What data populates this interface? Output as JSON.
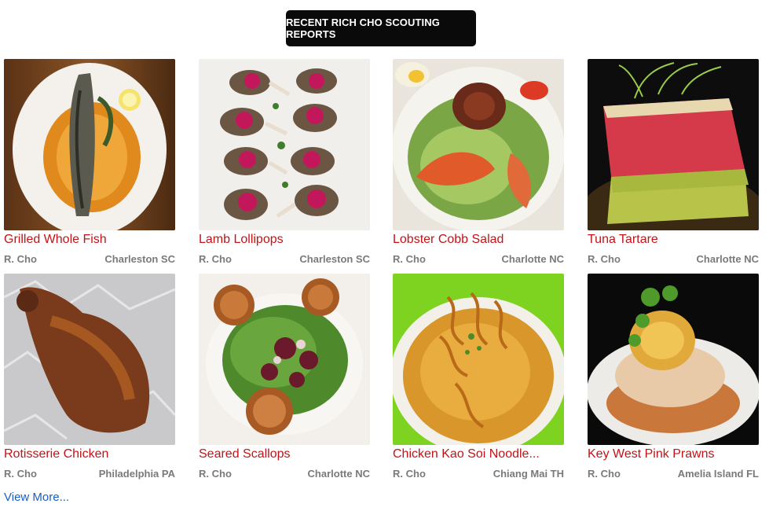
{
  "header": {
    "title": "RECENT RICH CHO SCOUTING REPORTS"
  },
  "cards": [
    {
      "title": "Grilled Whole Fish",
      "author": "R. Cho",
      "location": "Charleston SC",
      "image_icon": "grilled-fish-photo"
    },
    {
      "title": "Lamb Lollipops",
      "author": "R. Cho",
      "location": "Charleston SC",
      "image_icon": "lamb-lollipops-photo"
    },
    {
      "title": "Lobster Cobb Salad",
      "author": "R. Cho",
      "location": "Charlotte NC",
      "image_icon": "lobster-salad-photo"
    },
    {
      "title": "Tuna Tartare",
      "author": "R. Cho",
      "location": "Charlotte NC",
      "image_icon": "tuna-tartare-photo"
    },
    {
      "title": "Rotisserie Chicken",
      "author": "R. Cho",
      "location": "Philadelphia PA",
      "image_icon": "rotisserie-chicken-photo"
    },
    {
      "title": "Seared Scallops",
      "author": "R. Cho",
      "location": "Charlotte NC",
      "image_icon": "seared-scallops-photo"
    },
    {
      "title": "Chicken Kao Soi Noodle...",
      "author": "R. Cho",
      "location": "Chiang Mai TH",
      "image_icon": "kao-soi-photo"
    },
    {
      "title": "Key West Pink Prawns",
      "author": "R. Cho",
      "location": "Amelia Island FL",
      "image_icon": "pink-prawns-photo"
    }
  ],
  "footer": {
    "view_more": "View More..."
  },
  "colors": {
    "title_red": "#c31317",
    "meta_gray": "#7a7a7a",
    "link_blue": "#1a5ec2",
    "header_bg": "#0a0a0a"
  }
}
